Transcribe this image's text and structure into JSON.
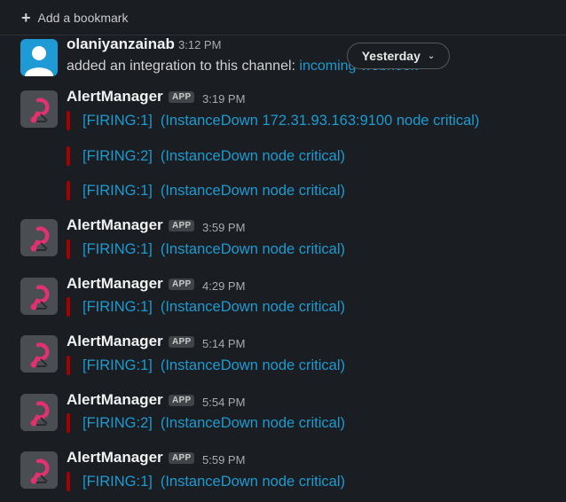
{
  "bookmark": {
    "label": "Add a bookmark"
  },
  "date_divider": {
    "label": "Yesterday"
  },
  "colors": {
    "link": "#1d9bd1",
    "firing_bar": "#a30200",
    "background": "#1a1d21"
  },
  "messages": [
    {
      "sender": "olaniyanzainab",
      "time": "3:12 PM",
      "text": "added an integration to this channel: ",
      "link": "incoming-webhook",
      "attachments": []
    },
    {
      "sender": "AlertManager",
      "badge": "APP",
      "time": "3:19 PM",
      "attachments": [
        {
          "status": "[FIRING:1]",
          "detail": "(InstanceDown 172.31.93.163:9100 node critical)"
        },
        {
          "status": "[FIRING:2]",
          "detail": "(InstanceDown node critical)"
        },
        {
          "status": "[FIRING:1]",
          "detail": "(InstanceDown node critical)"
        }
      ]
    },
    {
      "sender": "AlertManager",
      "badge": "APP",
      "time": "3:59 PM",
      "attachments": [
        {
          "status": "[FIRING:1]",
          "detail": "(InstanceDown node critical)"
        }
      ]
    },
    {
      "sender": "AlertManager",
      "badge": "APP",
      "time": "4:29 PM",
      "attachments": [
        {
          "status": "[FIRING:1]",
          "detail": "(InstanceDown node critical)"
        }
      ]
    },
    {
      "sender": "AlertManager",
      "badge": "APP",
      "time": "5:14 PM",
      "attachments": [
        {
          "status": "[FIRING:1]",
          "detail": "(InstanceDown node critical)"
        }
      ]
    },
    {
      "sender": "AlertManager",
      "badge": "APP",
      "time": "5:54 PM",
      "attachments": [
        {
          "status": "[FIRING:2]",
          "detail": "(InstanceDown node critical)"
        }
      ]
    },
    {
      "sender": "AlertManager",
      "badge": "APP",
      "time": "5:59 PM",
      "attachments": [
        {
          "status": "[FIRING:1]",
          "detail": "(InstanceDown node critical)"
        }
      ]
    }
  ]
}
